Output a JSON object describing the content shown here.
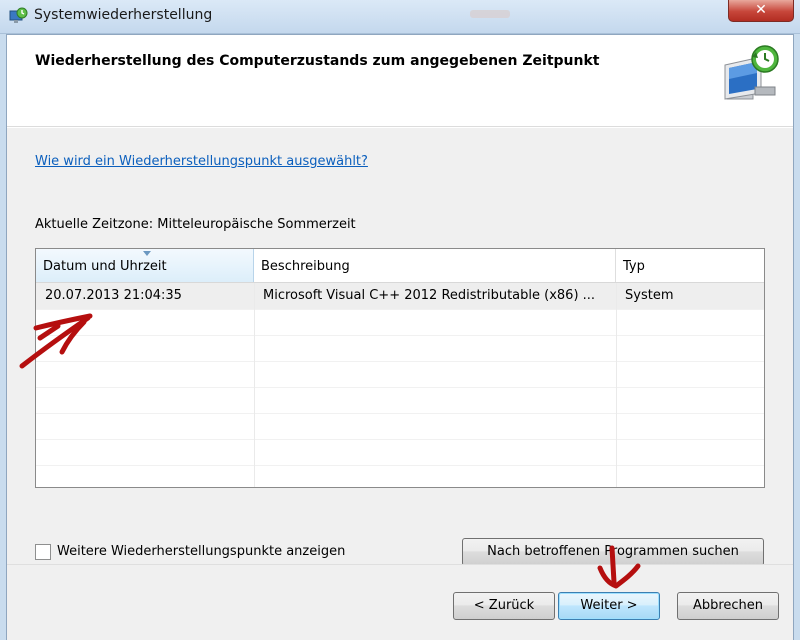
{
  "window": {
    "title": "Systemwiederherstellung",
    "close_label": "✕"
  },
  "header": {
    "title": "Wiederherstellung des Computerzustands zum angegebenen Zeitpunkt",
    "icon": "system-restore-monitor-icon"
  },
  "main": {
    "help_link": "Wie wird ein Wiederherstellungspunkt ausgewählt?",
    "timezone_label": "Aktuelle Zeitzone: Mitteleuropäische Sommerzeit",
    "table": {
      "columns": [
        "Datum und Uhrzeit",
        "Beschreibung",
        "Typ"
      ],
      "sorted_column": "Datum und Uhrzeit",
      "rows": [
        [
          "20.07.2013 21:04:35",
          "Microsoft Visual C++ 2012 Redistributable (x86) ...",
          "System"
        ]
      ]
    },
    "show_more_checkbox": {
      "label": "Weitere Wiederherstellungspunkte anzeigen",
      "checked": false
    },
    "scan_button": "Nach betroffenen Programmen suchen"
  },
  "footer": {
    "back_button": "< Zurück",
    "next_button": "Weiter >",
    "cancel_button": "Abbrechen"
  },
  "colors": {
    "link": "#0b5fbd",
    "annotation": "#b50f0f"
  }
}
